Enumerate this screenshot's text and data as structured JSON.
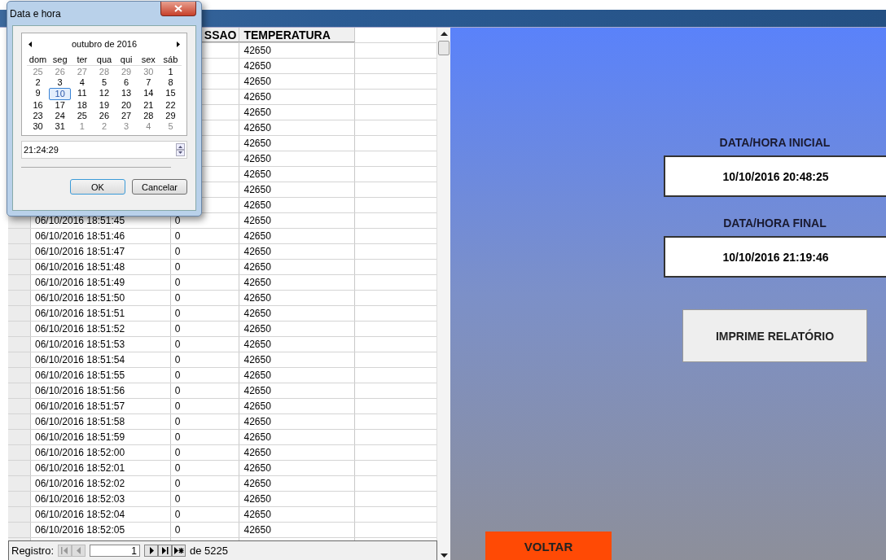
{
  "table": {
    "columns": [
      {
        "label": "SSAO"
      },
      {
        "label": "TEMPERATURA"
      }
    ],
    "rows": [
      {
        "temperatura": "42650"
      },
      {
        "temperatura": "42650"
      },
      {
        "temperatura": "42650"
      },
      {
        "temperatura": "42650"
      },
      {
        "temperatura": "42650"
      },
      {
        "temperatura": "42650"
      },
      {
        "temperatura": "42650"
      },
      {
        "temperatura": "42650"
      },
      {
        "temperatura": "42650"
      },
      {
        "temperatura": "42650"
      },
      {
        "temperatura": "42650"
      },
      {
        "data": "06/10/2016 18:51:45",
        "pressao": "0",
        "temperatura": "42650"
      },
      {
        "data": "06/10/2016 18:51:46",
        "pressao": "0",
        "temperatura": "42650"
      },
      {
        "data": "06/10/2016 18:51:47",
        "pressao": "0",
        "temperatura": "42650"
      },
      {
        "data": "06/10/2016 18:51:48",
        "pressao": "0",
        "temperatura": "42650"
      },
      {
        "data": "06/10/2016 18:51:49",
        "pressao": "0",
        "temperatura": "42650"
      },
      {
        "data": "06/10/2016 18:51:50",
        "pressao": "0",
        "temperatura": "42650"
      },
      {
        "data": "06/10/2016 18:51:51",
        "pressao": "0",
        "temperatura": "42650"
      },
      {
        "data": "06/10/2016 18:51:52",
        "pressao": "0",
        "temperatura": "42650"
      },
      {
        "data": "06/10/2016 18:51:53",
        "pressao": "0",
        "temperatura": "42650"
      },
      {
        "data": "06/10/2016 18:51:54",
        "pressao": "0",
        "temperatura": "42650"
      },
      {
        "data": "06/10/2016 18:51:55",
        "pressao": "0",
        "temperatura": "42650"
      },
      {
        "data": "06/10/2016 18:51:56",
        "pressao": "0",
        "temperatura": "42650"
      },
      {
        "data": "06/10/2016 18:51:57",
        "pressao": "0",
        "temperatura": "42650"
      },
      {
        "data": "06/10/2016 18:51:58",
        "pressao": "0",
        "temperatura": "42650"
      },
      {
        "data": "06/10/2016 18:51:59",
        "pressao": "0",
        "temperatura": "42650"
      },
      {
        "data": "06/10/2016 18:52:00",
        "pressao": "0",
        "temperatura": "42650"
      },
      {
        "data": "06/10/2016 18:52:01",
        "pressao": "0",
        "temperatura": "42650"
      },
      {
        "data": "06/10/2016 18:52:02",
        "pressao": "0",
        "temperatura": "42650"
      },
      {
        "data": "06/10/2016 18:52:03",
        "pressao": "0",
        "temperatura": "42650"
      },
      {
        "data": "06/10/2016 18:52:04",
        "pressao": "0",
        "temperatura": "42650"
      },
      {
        "data": "06/10/2016 18:52:05",
        "pressao": "0",
        "temperatura": "42650"
      },
      {}
    ]
  },
  "navigator": {
    "label": "Registro:",
    "record": "1",
    "total": "de 5225"
  },
  "dialog": {
    "title": "Data e hora",
    "month": "outubro de 2016",
    "weekdays": [
      "dom",
      "seg",
      "ter",
      "qua",
      "qui",
      "sex",
      "sáb"
    ],
    "weeks": [
      [
        {
          "day": "25",
          "other_month": true,
          "selected": false
        },
        {
          "day": "26",
          "other_month": true,
          "selected": false
        },
        {
          "day": "27",
          "other_month": true,
          "selected": false
        },
        {
          "day": "28",
          "other_month": true,
          "selected": false
        },
        {
          "day": "29",
          "other_month": true,
          "selected": false
        },
        {
          "day": "30",
          "other_month": true,
          "selected": false
        },
        {
          "day": "1",
          "other_month": false,
          "selected": false
        }
      ],
      [
        {
          "day": "2",
          "other_month": false,
          "selected": false
        },
        {
          "day": "3",
          "other_month": false,
          "selected": false
        },
        {
          "day": "4",
          "other_month": false,
          "selected": false
        },
        {
          "day": "5",
          "other_month": false,
          "selected": false
        },
        {
          "day": "6",
          "other_month": false,
          "selected": false
        },
        {
          "day": "7",
          "other_month": false,
          "selected": false
        },
        {
          "day": "8",
          "other_month": false,
          "selected": false
        }
      ],
      [
        {
          "day": "9",
          "other_month": false,
          "selected": false
        },
        {
          "day": "10",
          "other_month": false,
          "selected": true
        },
        {
          "day": "11",
          "other_month": false,
          "selected": false
        },
        {
          "day": "12",
          "other_month": false,
          "selected": false
        },
        {
          "day": "13",
          "other_month": false,
          "selected": false
        },
        {
          "day": "14",
          "other_month": false,
          "selected": false
        },
        {
          "day": "15",
          "other_month": false,
          "selected": false
        }
      ],
      [
        {
          "day": "16",
          "other_month": false,
          "selected": false
        },
        {
          "day": "17",
          "other_month": false,
          "selected": false
        },
        {
          "day": "18",
          "other_month": false,
          "selected": false
        },
        {
          "day": "19",
          "other_month": false,
          "selected": false
        },
        {
          "day": "20",
          "other_month": false,
          "selected": false
        },
        {
          "day": "21",
          "other_month": false,
          "selected": false
        },
        {
          "day": "22",
          "other_month": false,
          "selected": false
        }
      ],
      [
        {
          "day": "23",
          "other_month": false,
          "selected": false
        },
        {
          "day": "24",
          "other_month": false,
          "selected": false
        },
        {
          "day": "25",
          "other_month": false,
          "selected": false
        },
        {
          "day": "26",
          "other_month": false,
          "selected": false
        },
        {
          "day": "27",
          "other_month": false,
          "selected": false
        },
        {
          "day": "28",
          "other_month": false,
          "selected": false
        },
        {
          "day": "29",
          "other_month": false,
          "selected": false
        }
      ],
      [
        {
          "day": "30",
          "other_month": false,
          "selected": false
        },
        {
          "day": "31",
          "other_month": false,
          "selected": false
        },
        {
          "day": "1",
          "other_month": true,
          "selected": false
        },
        {
          "day": "2",
          "other_month": true,
          "selected": false
        },
        {
          "day": "3",
          "other_month": true,
          "selected": false
        },
        {
          "day": "4",
          "other_month": true,
          "selected": false
        },
        {
          "day": "5",
          "other_month": true,
          "selected": false
        }
      ]
    ],
    "time": "21:24:29",
    "buttons": [
      "OK",
      "Cancelar"
    ]
  },
  "panel": {
    "fields": [
      {
        "label": "DATA/HORA INICIAL",
        "value": "10/10/2016 20:48:25"
      },
      {
        "label": "DATA/HORA FINAL",
        "value": "10/10/2016 21:19:46"
      }
    ],
    "print_button": "IMPRIME RELATÓRIO",
    "back_button": "VOLTAR"
  }
}
